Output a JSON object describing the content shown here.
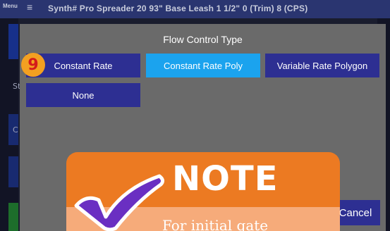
{
  "background_app": {
    "menu_label": "Menu",
    "menu_icon": "hamburger-icon",
    "header_text": "Synth#   Pro Spreader 20 93\"   Base Leash 1 1/2\" 0 (Trim)   8 (CPS)",
    "side_labels": [
      "St",
      "C"
    ]
  },
  "dialog": {
    "title": "Flow Control Type",
    "options": [
      {
        "label": "Constant Rate",
        "selected": false
      },
      {
        "label": "Constant Rate Poly",
        "selected": true
      },
      {
        "label": "Variable Rate Polygon",
        "selected": false
      },
      {
        "label": "None",
        "selected": false
      }
    ],
    "cancel_label": "Cancel"
  },
  "step_badge": "9",
  "note": {
    "title": "NOTE",
    "text": "For initial gate",
    "icon": "checkmark-icon"
  },
  "colors": {
    "selected_option": "#1ba3ee",
    "option": "#2d2f92",
    "note_header": "#ec7a22",
    "note_body": "#f6ab7a",
    "badge": "#f3a021"
  }
}
